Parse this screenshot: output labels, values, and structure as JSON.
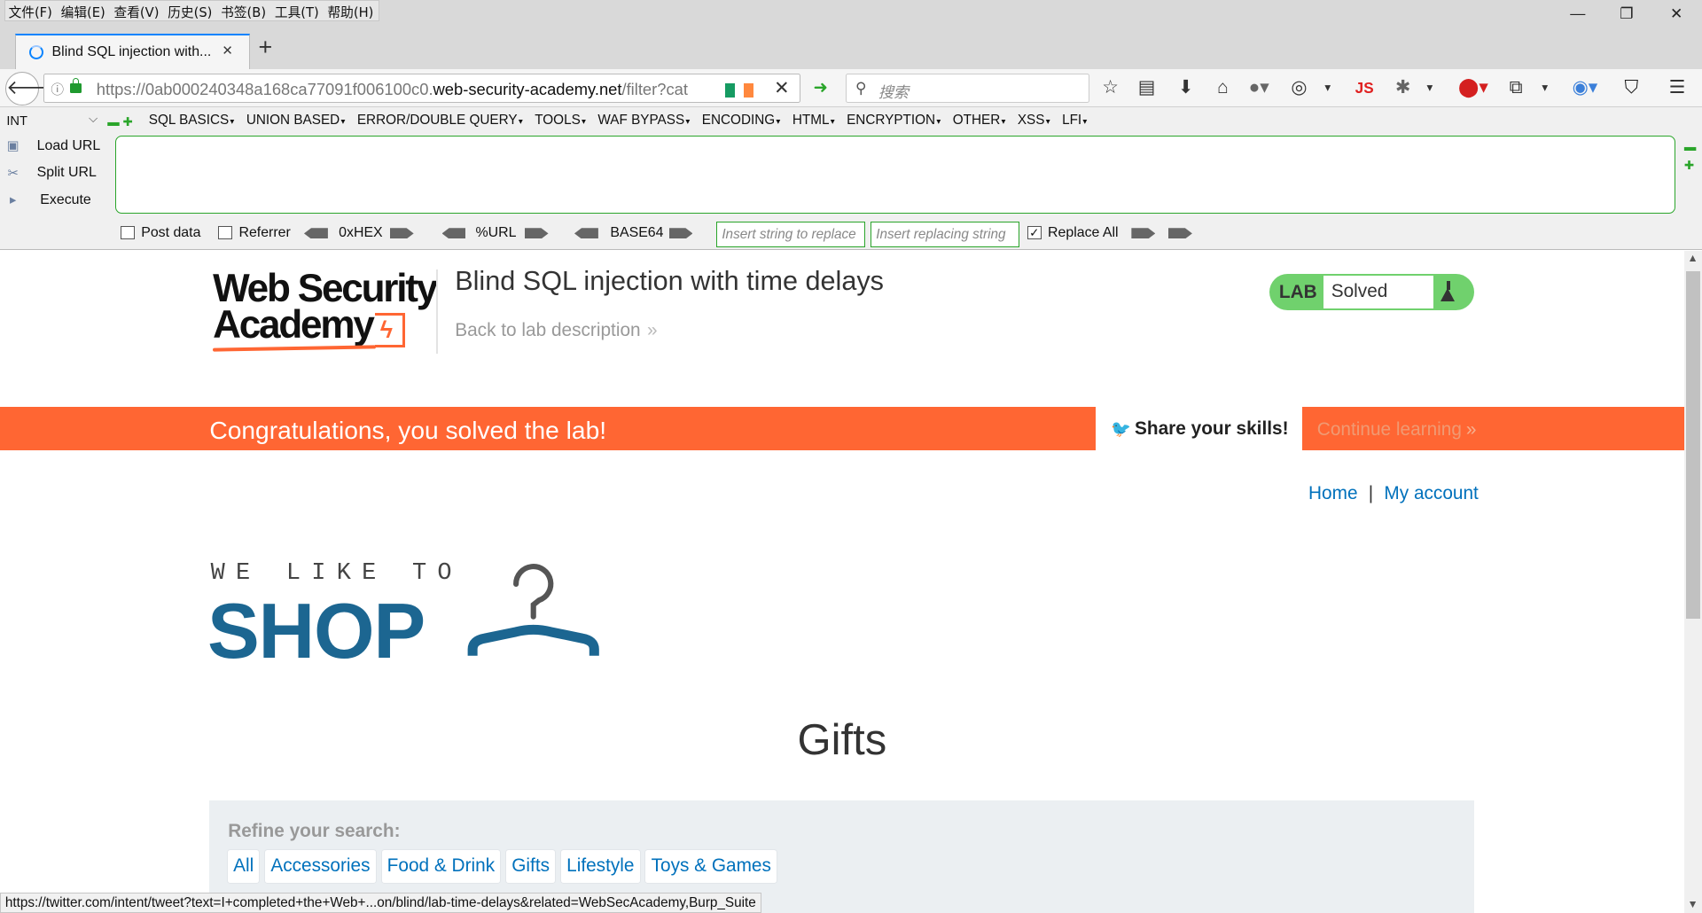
{
  "menubar": {
    "items": [
      "文件(F)",
      "编辑(E)",
      "查看(V)",
      "历史(S)",
      "书签(B)",
      "工具(T)",
      "帮助(H)"
    ]
  },
  "tab": {
    "title": "Blind SQL injection with...",
    "close": "×",
    "new_tab": "+"
  },
  "address_bar": {
    "url_prefix": "https://0ab000240348a168ca77091f006100c0.",
    "url_domain": "web-security-academy.net",
    "url_suffix": "/filter?cat",
    "flag_colors": [
      "#169b62",
      "#ffffff",
      "#ff883e"
    ]
  },
  "search": {
    "placeholder": "搜索"
  },
  "toolbar_icons": [
    "bookmark-star-icon",
    "reading-list-icon",
    "download-icon",
    "home-icon",
    "globe-icon",
    "palette-icon",
    "js-icon",
    "bug-icon",
    "red-circle-icon",
    "device-icon",
    "chrome-icon",
    "shield-icon",
    "menu-icon"
  ],
  "toolbar": {
    "js_label": "JS"
  },
  "hackbar": {
    "select_value": "INT",
    "menus": [
      "SQL BASICS",
      "UNION BASED",
      "ERROR/DOUBLE QUERY",
      "TOOLS",
      "WAF BYPASS",
      "ENCODING",
      "HTML",
      "ENCRYPTION",
      "OTHER",
      "XSS",
      "LFI"
    ],
    "side_actions": [
      "Load URL",
      "Split URL",
      "Execute"
    ],
    "textarea_value": "",
    "post_data": "Post data",
    "referrer": "Referrer",
    "hex": "0xHEX",
    "url_enc": "%URL",
    "base64": "BASE64",
    "replace_placeholder": "Insert string to replace",
    "replacing_placeholder": "Insert replacing string",
    "replace_all": "Replace All",
    "replace_all_checked": true
  },
  "lab_header": {
    "logo_line1": "Web Security",
    "logo_line2": "Academy",
    "title": "Blind SQL injection with time delays",
    "back_link": "Back to lab description",
    "chevrons": "»",
    "status_tag": "LAB",
    "status": "Solved",
    "status_color": "#70d16d"
  },
  "banner": {
    "message": "Congratulations, you solved the lab!",
    "share": "Share your skills!",
    "continue": "Continue learning",
    "color": "#ff6633"
  },
  "nav": {
    "home": "Home",
    "separator": "|",
    "account": "My account"
  },
  "shop": {
    "tagline": "WE LIKE TO",
    "name": "SHOP"
  },
  "category_heading": "Gifts",
  "refine": {
    "label": "Refine your search:",
    "filters": [
      "All",
      "Accessories",
      "Food & Drink",
      "Gifts",
      "Lifestyle",
      "Toys & Games"
    ]
  },
  "status_url": "https://twitter.com/intent/tweet?text=I+completed+the+Web+...on/blind/lab-time-delays&related=WebSecAcademy,Burp_Suite"
}
